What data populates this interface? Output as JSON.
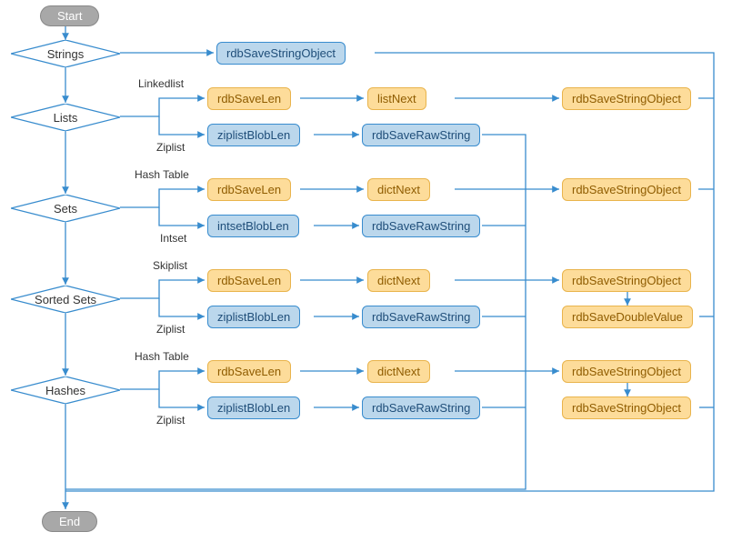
{
  "terminals": {
    "start": "Start",
    "end": "End"
  },
  "decisions": {
    "strings": "Strings",
    "lists": "Lists",
    "sets": "Sets",
    "sorted_sets": "Sorted Sets",
    "hashes": "Hashes"
  },
  "nodes": {
    "strings": {
      "save": "rdbSaveStringObject"
    },
    "lists": {
      "linkedlist_label": "Linkedlist",
      "ziplist_label": "Ziplist",
      "saveLen": "rdbSaveLen",
      "listNext": "listNext",
      "saveStrObj": "rdbSaveStringObject",
      "ziplistBlobLen": "ziplistBlobLen",
      "saveRawStr": "rdbSaveRawString"
    },
    "sets": {
      "hash_table_label": "Hash Table",
      "intset_label": "Intset",
      "saveLen": "rdbSaveLen",
      "dictNext": "dictNext",
      "saveStrObj": "rdbSaveStringObject",
      "intsetBlobLen": "intsetBlobLen",
      "saveRawStr": "rdbSaveRawString"
    },
    "sorted_sets": {
      "skiplist_label": "Skiplist",
      "ziplist_label": "Ziplist",
      "saveLen": "rdbSaveLen",
      "dictNext": "dictNext",
      "saveStrObj": "rdbSaveStringObject",
      "saveDouble": "rdbSaveDoubleValue",
      "ziplistBlobLen": "ziplistBlobLen",
      "saveRawStr": "rdbSaveRawString"
    },
    "hashes": {
      "hash_table_label": "Hash Table",
      "ziplist_label": "Ziplist",
      "saveLen": "rdbSaveLen",
      "dictNext": "dictNext",
      "saveStrObj1": "rdbSaveStringObject",
      "saveStrObj2": "rdbSaveStringObject",
      "ziplistBlobLen": "ziplistBlobLen",
      "saveRawStr": "rdbSaveRawString"
    }
  }
}
